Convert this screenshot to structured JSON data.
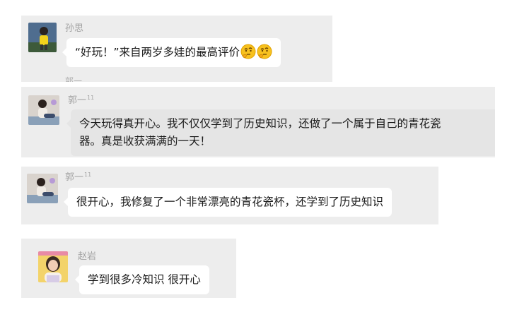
{
  "messages": [
    {
      "name": "孙思",
      "text": "“好玩！”来自两岁多娃的最高评价",
      "emojis": [
        "thinking-face-emoji",
        "thinking-face-emoji"
      ]
    },
    {
      "name": "郭一",
      "name_sup": "11",
      "text_lines": [
        "今天玩得真开心。我不仅仅学到了历史知识，还做了一个属于自己的青花瓷",
        "器。真是收获满满的一天！"
      ]
    },
    {
      "name": "郭一",
      "name_sup": "11",
      "text": "很开心，我修复了一个非常漂亮的青花瓷杯，还学到了历史知识"
    },
    {
      "name": "赵岩",
      "text": "学到很多冷知识 很开心"
    }
  ],
  "colors": {
    "card_bg": "#ededed",
    "bubble_white": "#ffffff",
    "bubble_grey": "#e5e5e5",
    "name_text": "#a3a3a3",
    "message_text": "#1a1a1a"
  }
}
